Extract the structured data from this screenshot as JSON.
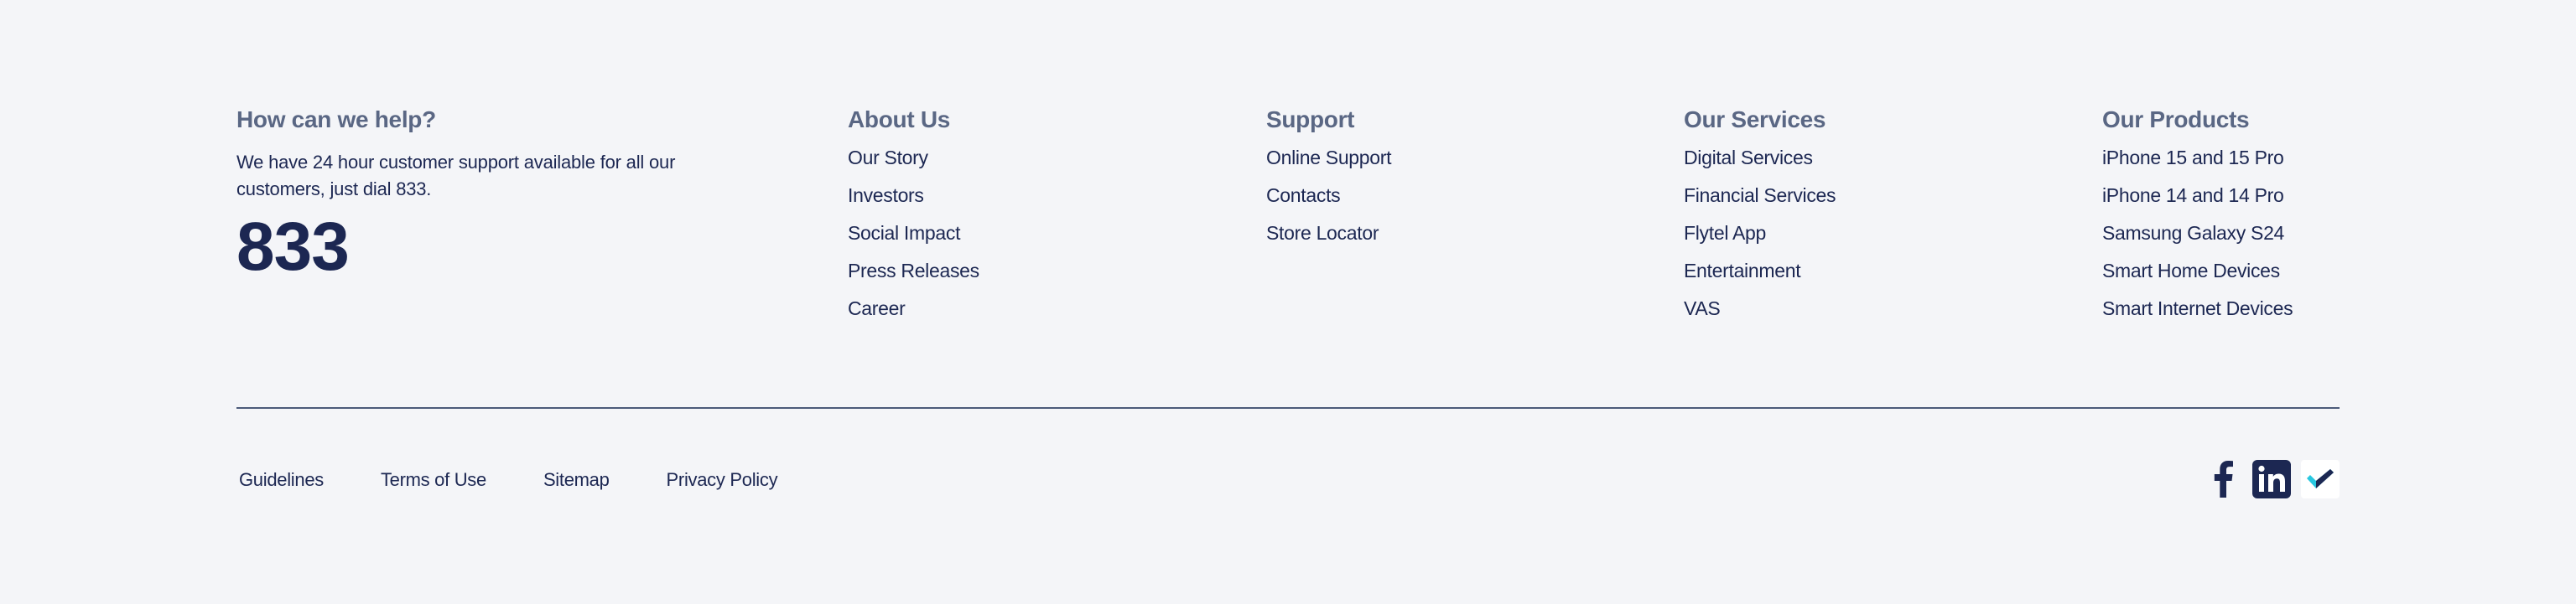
{
  "help": {
    "heading": "How can we help?",
    "text": "We have 24 hour customer support available for all our customers, just dial 833.",
    "number": "833"
  },
  "about": {
    "heading": "About Us",
    "items": [
      "Our Story",
      "Investors",
      "Social Impact",
      "Press Releases",
      "Career"
    ]
  },
  "support": {
    "heading": "Support",
    "items": [
      "Online Support",
      "Contacts",
      "Store Locator"
    ]
  },
  "services": {
    "heading": "Our Services",
    "items": [
      "Digital Services",
      "Financial Services",
      "Flytel App",
      "Entertainment",
      "VAS"
    ]
  },
  "products": {
    "heading": "Our Products",
    "items": [
      "iPhone 15 and 15 Pro",
      "iPhone 14 and 14 Pro",
      "Samsung Galaxy S24",
      "Smart Home Devices",
      "Smart Internet Devices"
    ]
  },
  "bottom_links": [
    "Guidelines",
    "Terms of Use",
    "Sitemap",
    "Privacy Policy"
  ],
  "socials": [
    {
      "icon": "facebook-icon"
    },
    {
      "icon": "linkedin-icon"
    },
    {
      "icon": "checkmark-app-icon"
    }
  ],
  "colors": {
    "background": "#f4f5f8",
    "text_primary": "#1c2752",
    "heading_muted": "#5a6784",
    "divider": "#4b5a79",
    "tick_cyan": "#27c7e0",
    "tick_navy": "#1c2752"
  }
}
